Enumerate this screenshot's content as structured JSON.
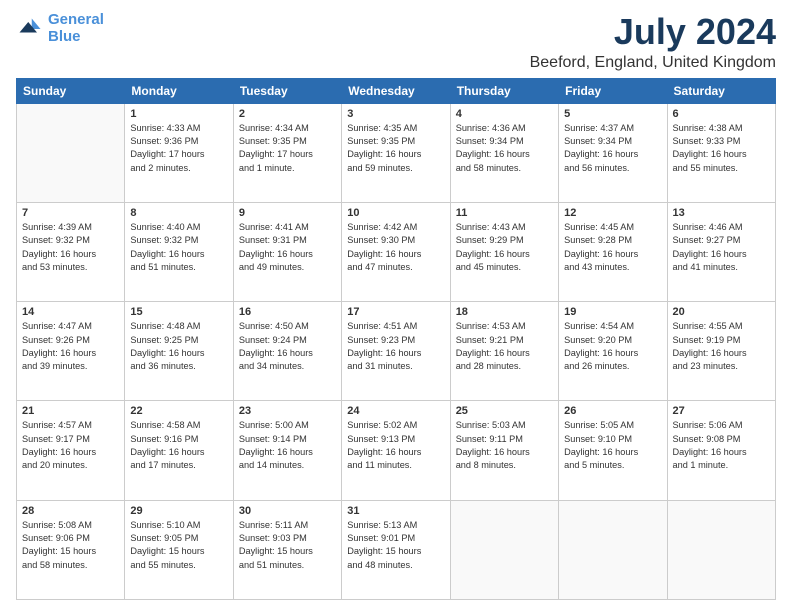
{
  "logo": {
    "line1": "General",
    "line2": "Blue"
  },
  "title": "July 2024",
  "subtitle": "Beeford, England, United Kingdom",
  "headers": [
    "Sunday",
    "Monday",
    "Tuesday",
    "Wednesday",
    "Thursday",
    "Friday",
    "Saturday"
  ],
  "weeks": [
    [
      {
        "day": "",
        "info": ""
      },
      {
        "day": "1",
        "info": "Sunrise: 4:33 AM\nSunset: 9:36 PM\nDaylight: 17 hours\nand 2 minutes."
      },
      {
        "day": "2",
        "info": "Sunrise: 4:34 AM\nSunset: 9:35 PM\nDaylight: 17 hours\nand 1 minute."
      },
      {
        "day": "3",
        "info": "Sunrise: 4:35 AM\nSunset: 9:35 PM\nDaylight: 16 hours\nand 59 minutes."
      },
      {
        "day": "4",
        "info": "Sunrise: 4:36 AM\nSunset: 9:34 PM\nDaylight: 16 hours\nand 58 minutes."
      },
      {
        "day": "5",
        "info": "Sunrise: 4:37 AM\nSunset: 9:34 PM\nDaylight: 16 hours\nand 56 minutes."
      },
      {
        "day": "6",
        "info": "Sunrise: 4:38 AM\nSunset: 9:33 PM\nDaylight: 16 hours\nand 55 minutes."
      }
    ],
    [
      {
        "day": "7",
        "info": "Sunrise: 4:39 AM\nSunset: 9:32 PM\nDaylight: 16 hours\nand 53 minutes."
      },
      {
        "day": "8",
        "info": "Sunrise: 4:40 AM\nSunset: 9:32 PM\nDaylight: 16 hours\nand 51 minutes."
      },
      {
        "day": "9",
        "info": "Sunrise: 4:41 AM\nSunset: 9:31 PM\nDaylight: 16 hours\nand 49 minutes."
      },
      {
        "day": "10",
        "info": "Sunrise: 4:42 AM\nSunset: 9:30 PM\nDaylight: 16 hours\nand 47 minutes."
      },
      {
        "day": "11",
        "info": "Sunrise: 4:43 AM\nSunset: 9:29 PM\nDaylight: 16 hours\nand 45 minutes."
      },
      {
        "day": "12",
        "info": "Sunrise: 4:45 AM\nSunset: 9:28 PM\nDaylight: 16 hours\nand 43 minutes."
      },
      {
        "day": "13",
        "info": "Sunrise: 4:46 AM\nSunset: 9:27 PM\nDaylight: 16 hours\nand 41 minutes."
      }
    ],
    [
      {
        "day": "14",
        "info": "Sunrise: 4:47 AM\nSunset: 9:26 PM\nDaylight: 16 hours\nand 39 minutes."
      },
      {
        "day": "15",
        "info": "Sunrise: 4:48 AM\nSunset: 9:25 PM\nDaylight: 16 hours\nand 36 minutes."
      },
      {
        "day": "16",
        "info": "Sunrise: 4:50 AM\nSunset: 9:24 PM\nDaylight: 16 hours\nand 34 minutes."
      },
      {
        "day": "17",
        "info": "Sunrise: 4:51 AM\nSunset: 9:23 PM\nDaylight: 16 hours\nand 31 minutes."
      },
      {
        "day": "18",
        "info": "Sunrise: 4:53 AM\nSunset: 9:21 PM\nDaylight: 16 hours\nand 28 minutes."
      },
      {
        "day": "19",
        "info": "Sunrise: 4:54 AM\nSunset: 9:20 PM\nDaylight: 16 hours\nand 26 minutes."
      },
      {
        "day": "20",
        "info": "Sunrise: 4:55 AM\nSunset: 9:19 PM\nDaylight: 16 hours\nand 23 minutes."
      }
    ],
    [
      {
        "day": "21",
        "info": "Sunrise: 4:57 AM\nSunset: 9:17 PM\nDaylight: 16 hours\nand 20 minutes."
      },
      {
        "day": "22",
        "info": "Sunrise: 4:58 AM\nSunset: 9:16 PM\nDaylight: 16 hours\nand 17 minutes."
      },
      {
        "day": "23",
        "info": "Sunrise: 5:00 AM\nSunset: 9:14 PM\nDaylight: 16 hours\nand 14 minutes."
      },
      {
        "day": "24",
        "info": "Sunrise: 5:02 AM\nSunset: 9:13 PM\nDaylight: 16 hours\nand 11 minutes."
      },
      {
        "day": "25",
        "info": "Sunrise: 5:03 AM\nSunset: 9:11 PM\nDaylight: 16 hours\nand 8 minutes."
      },
      {
        "day": "26",
        "info": "Sunrise: 5:05 AM\nSunset: 9:10 PM\nDaylight: 16 hours\nand 5 minutes."
      },
      {
        "day": "27",
        "info": "Sunrise: 5:06 AM\nSunset: 9:08 PM\nDaylight: 16 hours\nand 1 minute."
      }
    ],
    [
      {
        "day": "28",
        "info": "Sunrise: 5:08 AM\nSunset: 9:06 PM\nDaylight: 15 hours\nand 58 minutes."
      },
      {
        "day": "29",
        "info": "Sunrise: 5:10 AM\nSunset: 9:05 PM\nDaylight: 15 hours\nand 55 minutes."
      },
      {
        "day": "30",
        "info": "Sunrise: 5:11 AM\nSunset: 9:03 PM\nDaylight: 15 hours\nand 51 minutes."
      },
      {
        "day": "31",
        "info": "Sunrise: 5:13 AM\nSunset: 9:01 PM\nDaylight: 15 hours\nand 48 minutes."
      },
      {
        "day": "",
        "info": ""
      },
      {
        "day": "",
        "info": ""
      },
      {
        "day": "",
        "info": ""
      }
    ]
  ]
}
